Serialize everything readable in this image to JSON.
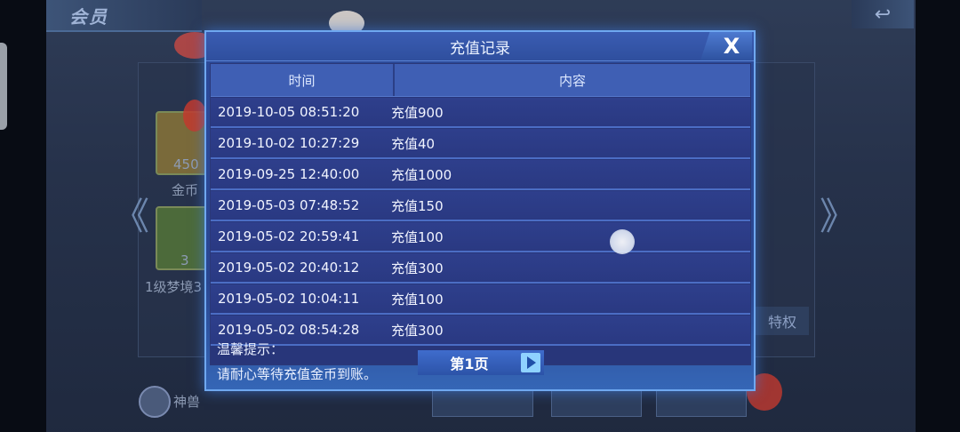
{
  "background": {
    "header_tab": "会员",
    "back_icon": "back-arrow-icon",
    "left_arrow": "《",
    "right_arrow": "》",
    "card1_value": "450",
    "card1_label": "金币",
    "card2_value": "3",
    "card2_label": "1级梦境3",
    "privilege_button": "特权",
    "bottom_label": "神兽"
  },
  "dialog": {
    "title": "充值记录",
    "close_label": "X",
    "columns": {
      "time": "时间",
      "content": "内容"
    },
    "rows": [
      {
        "time": "2019-10-05 08:51:20",
        "content": "充值900"
      },
      {
        "time": "2019-10-02 10:27:29",
        "content": "充值40"
      },
      {
        "time": "2019-09-25 12:40:00",
        "content": "充值1000"
      },
      {
        "time": "2019-05-03 07:48:52",
        "content": "充值150"
      },
      {
        "time": "2019-05-02 20:59:41",
        "content": "充值100"
      },
      {
        "time": "2019-05-02 20:40:12",
        "content": "充值300"
      },
      {
        "time": "2019-05-02 10:04:11",
        "content": "充值100"
      },
      {
        "time": "2019-05-02 08:54:28",
        "content": "充值300"
      }
    ],
    "tip_label": "温馨提示：",
    "tip_text": "请耐心等待充值金币到账。",
    "pager": {
      "label": "第1页",
      "next_icon": "play-right-icon"
    }
  },
  "colors": {
    "dialog_border": "#6fa8f0",
    "header_row": "#3f5fb4",
    "row_bg": "#2e3f8c",
    "row_separator": "#4b6dc4"
  }
}
